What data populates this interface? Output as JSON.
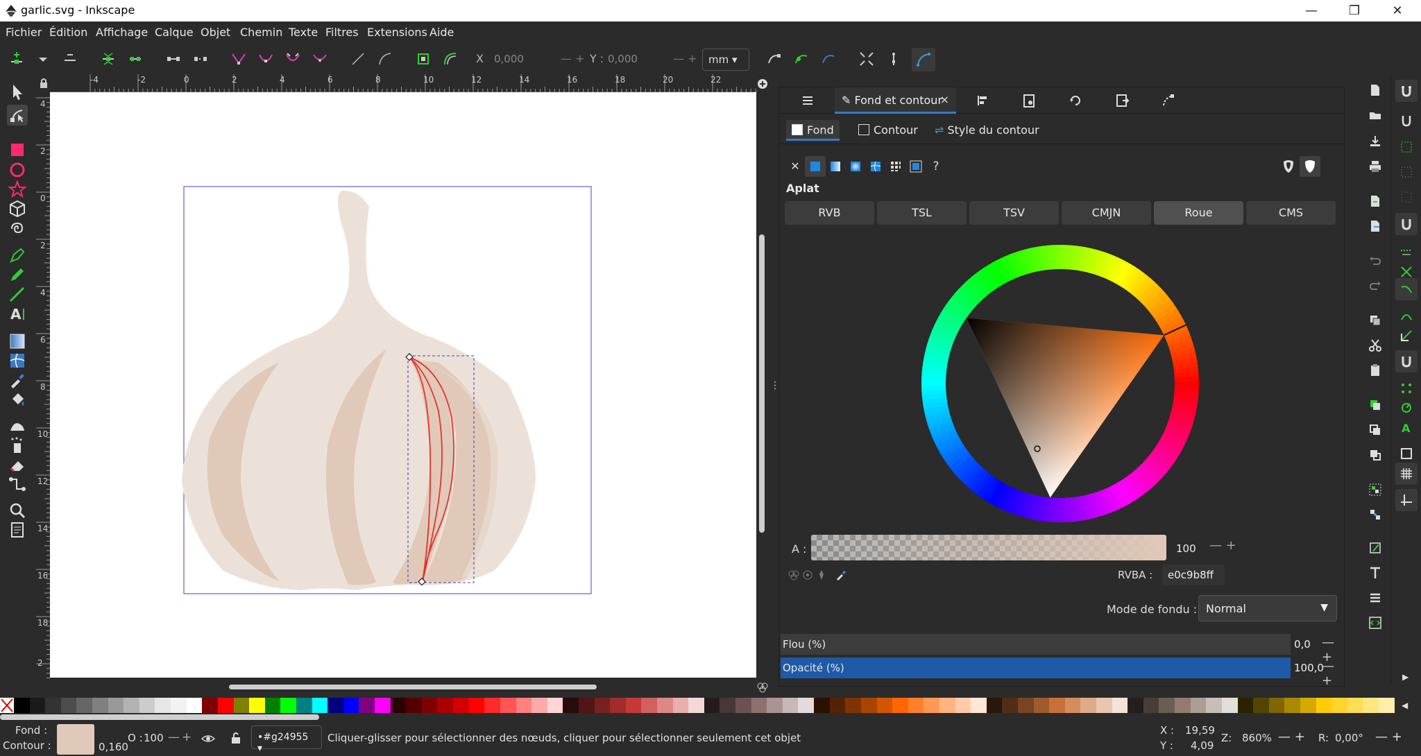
{
  "window": {
    "title": "garlic.svg - Inkscape",
    "minimize_glyph": "—",
    "restore_glyph": "❐",
    "close_glyph": "✕"
  },
  "menu": [
    "Fichier",
    "Édition",
    "Affichage",
    "Calque",
    "Objet",
    "Chemin",
    "Texte",
    "Filtres",
    "Extensions",
    "Aide"
  ],
  "tool_controls": {
    "x_label": "X :",
    "x_value": "0,000",
    "y_label": "Y :",
    "y_value": "0,000",
    "unit": "mm",
    "plus_minus": "— +"
  },
  "rulers": {
    "horizontal": [
      "-4",
      "-2",
      "0",
      "2",
      "4",
      "6",
      "8",
      "10",
      "12",
      "14",
      "16",
      "18",
      "20",
      "22"
    ],
    "vertical": [
      "4",
      "2",
      "0",
      "2",
      "4",
      "6",
      "8",
      "10",
      "12",
      "14",
      "16",
      "18",
      "20",
      "2"
    ]
  },
  "dock": {
    "active_tab": "Fond et contour",
    "subtabs": [
      "Fond",
      "Contour",
      "Style du contour"
    ],
    "paint_label": "Aplat",
    "color_modes": [
      "RVB",
      "TSL",
      "TSV",
      "CMJN",
      "Roue",
      "CMS"
    ],
    "active_mode": "Roue",
    "alpha_label": "A :",
    "alpha_value": "100",
    "rgba_label": "RVBA :",
    "rgba_value": "e0c9b8ff",
    "blend_label": "Mode de fondu :",
    "blend_value": "Normal",
    "blur_label": "Flou (%)",
    "blur_value": "0,0",
    "opacity_label": "Opacité (%)",
    "opacity_value": "100,0",
    "unset_glyph": "✕",
    "unknown_glyph": "?"
  },
  "status": {
    "fill_label": "Fond :",
    "stroke_label": "Contour :",
    "stroke_width": "0,160",
    "opacity_label": "O :",
    "opacity_value": "100",
    "layer": "•#g24955",
    "message": "Cliquer-glisser pour sélectionner des nœuds, cliquer pour sélectionner seulement cet objet",
    "x_label": "X :",
    "x_value": "19,59",
    "y_label": "Y :",
    "y_value": "4,09",
    "zoom_label": "Z:",
    "zoom_value": "860%",
    "rotation_label": "R:",
    "rotation_value": "0,00°"
  },
  "colors": {
    "fill": "#e0c9b8",
    "accent": "#3a78c5",
    "garlic_light": "#ece1d8",
    "garlic_dark": "#e0c9b8",
    "selection_red": "#e8302a"
  },
  "palette": [
    "#000000",
    "#1a1a1a",
    "#333333",
    "#4d4d4d",
    "#666666",
    "#808080",
    "#999999",
    "#b3b3b3",
    "#cccccc",
    "#e6e6e6",
    "#f2f2f2",
    "#ffffff",
    "#800000",
    "#ff0000",
    "#808000",
    "#ffff00",
    "#008000",
    "#00ff00",
    "#008080",
    "#00ffff",
    "#000080",
    "#0000ff",
    "#800080",
    "#ff00ff",
    "#2b0000",
    "#550000",
    "#800000",
    "#aa0000",
    "#d40000",
    "#ff0000",
    "#ff2a2a",
    "#ff5555",
    "#ff8080",
    "#ffaaaa",
    "#ffd5d5",
    "#280b0b",
    "#501616",
    "#782121",
    "#a02c2c",
    "#c83737",
    "#d35f5f",
    "#de8787",
    "#e9afaf",
    "#f4d7d7",
    "#241c1c",
    "#483737",
    "#6c5353",
    "#916f6f",
    "#ac9393",
    "#c8b7b7",
    "#e3dbdb",
    "#2b1100",
    "#552200",
    "#803300",
    "#aa4400",
    "#d45500",
    "#ff6600",
    "#ff7f2a",
    "#ff9955",
    "#ffb380",
    "#ffccaa",
    "#ffe6d5",
    "#28170b",
    "#502d16",
    "#784421",
    "#a05a2c",
    "#c87137",
    "#d38d5f",
    "#deaa87",
    "#e9c6af",
    "#f4e3d7",
    "#241f1c",
    "#483e37",
    "#6c5d53",
    "#917c6f",
    "#ac9d93",
    "#c8beb7",
    "#e3dedb",
    "#2b2200",
    "#554400",
    "#806600",
    "#aa8800",
    "#d4aa00",
    "#ffcc00",
    "#ffd42a",
    "#ffdd55",
    "#ffe680",
    "#ffeeaa"
  ],
  "commands_icons": [
    "new-document-icon",
    "open-icon",
    "save-icon",
    "print-icon",
    "import-icon",
    "export-icon",
    "undo-icon",
    "redo-icon",
    "copy-icon",
    "cut-icon",
    "paste-icon",
    "duplicate-icon",
    "clone-icon",
    "unlink-clone-icon",
    "group-icon",
    "ungroup-icon",
    "fill-stroke-icon",
    "text-icon",
    "layers-icon",
    "xml-editor-icon"
  ],
  "snap_icons": [
    "snap-toggle-icon",
    "snap-bbox-icon",
    "snap-bbox-edge-icon",
    "snap-bbox-corner-icon",
    "snap-bbox-midpoint-icon",
    "snap-nodes-icon",
    "snap-path-icon",
    "snap-intersection-icon",
    "snap-cusp-icon",
    "snap-smooth-icon",
    "snap-midpoint-icon",
    "snap-others-icon",
    "snap-center-icon",
    "snap-rotation-icon",
    "snap-text-icon",
    "snap-page-icon",
    "snap-grid-icon",
    "snap-guide-icon"
  ]
}
